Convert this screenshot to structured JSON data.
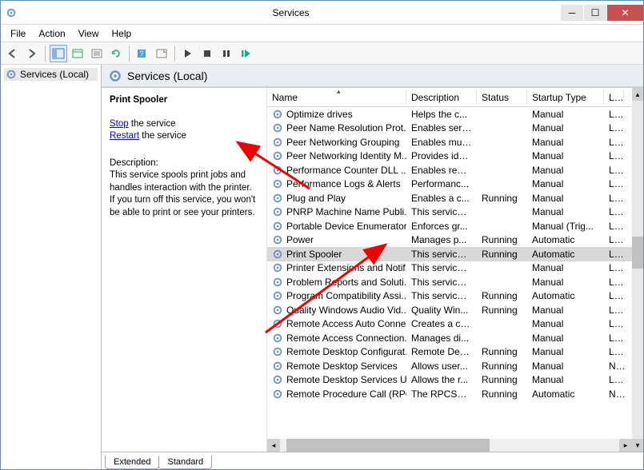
{
  "title": "Services",
  "menu": {
    "file": "File",
    "action": "Action",
    "view": "View",
    "help": "Help"
  },
  "tree": {
    "root": "Services (Local)"
  },
  "panelHeader": "Services (Local)",
  "detail": {
    "selectedName": "Print Spooler",
    "stop": "Stop",
    "stopText": " the service",
    "restart": "Restart",
    "restartText": " the service",
    "descLabel": "Description:",
    "desc": "This service spools print jobs and handles interaction with the printer. If you turn off this service, you won't be able to print or see your printers."
  },
  "columns": {
    "name": "Name",
    "desc": "Description",
    "status": "Status",
    "startup": "Startup Type",
    "logon": "Log"
  },
  "rows": [
    {
      "name": "Optimize drives",
      "desc": "Helps the c...",
      "status": "",
      "startup": "Manual",
      "logon": "Loc"
    },
    {
      "name": "Peer Name Resolution Prot...",
      "desc": "Enables serv...",
      "status": "",
      "startup": "Manual",
      "logon": "Loc"
    },
    {
      "name": "Peer Networking Grouping",
      "desc": "Enables mul...",
      "status": "",
      "startup": "Manual",
      "logon": "Loc"
    },
    {
      "name": "Peer Networking Identity M...",
      "desc": "Provides ide...",
      "status": "",
      "startup": "Manual",
      "logon": "Loc"
    },
    {
      "name": "Performance Counter DLL ...",
      "desc": "Enables rem...",
      "status": "",
      "startup": "Manual",
      "logon": "Loc"
    },
    {
      "name": "Performance Logs & Alerts",
      "desc": "Performanc...",
      "status": "",
      "startup": "Manual",
      "logon": "Loc"
    },
    {
      "name": "Plug and Play",
      "desc": "Enables a c...",
      "status": "Running",
      "startup": "Manual",
      "logon": "Loc"
    },
    {
      "name": "PNRP Machine Name Publi...",
      "desc": "This service ...",
      "status": "",
      "startup": "Manual",
      "logon": "Loc"
    },
    {
      "name": "Portable Device Enumerator...",
      "desc": "Enforces gr...",
      "status": "",
      "startup": "Manual (Trig...",
      "logon": "Loc"
    },
    {
      "name": "Power",
      "desc": "Manages p...",
      "status": "Running",
      "startup": "Automatic",
      "logon": "Loc"
    },
    {
      "name": "Print Spooler",
      "desc": "This service ...",
      "status": "Running",
      "startup": "Automatic",
      "logon": "Loc",
      "selected": true
    },
    {
      "name": "Printer Extensions and Notif...",
      "desc": "This service ...",
      "status": "",
      "startup": "Manual",
      "logon": "Loc"
    },
    {
      "name": "Problem Reports and Soluti...",
      "desc": "This service ...",
      "status": "",
      "startup": "Manual",
      "logon": "Loc"
    },
    {
      "name": "Program Compatibility Assi...",
      "desc": "This service ...",
      "status": "Running",
      "startup": "Automatic",
      "logon": "Loc"
    },
    {
      "name": "Quality Windows Audio Vid...",
      "desc": "Quality Win...",
      "status": "Running",
      "startup": "Manual",
      "logon": "Loc"
    },
    {
      "name": "Remote Access Auto Conne...",
      "desc": "Creates a co...",
      "status": "",
      "startup": "Manual",
      "logon": "Loc"
    },
    {
      "name": "Remote Access Connection...",
      "desc": "Manages di...",
      "status": "",
      "startup": "Manual",
      "logon": "Loc"
    },
    {
      "name": "Remote Desktop Configurat...",
      "desc": "Remote Des...",
      "status": "Running",
      "startup": "Manual",
      "logon": "Loc"
    },
    {
      "name": "Remote Desktop Services",
      "desc": "Allows user...",
      "status": "Running",
      "startup": "Manual",
      "logon": "Net"
    },
    {
      "name": "Remote Desktop Services U...",
      "desc": "Allows the r...",
      "status": "Running",
      "startup": "Manual",
      "logon": "Loc"
    },
    {
      "name": "Remote Procedure Call (RPC)",
      "desc": "The RPCSS ...",
      "status": "Running",
      "startup": "Automatic",
      "logon": "Net"
    }
  ],
  "tabs": {
    "extended": "Extended",
    "standard": "Standard"
  }
}
